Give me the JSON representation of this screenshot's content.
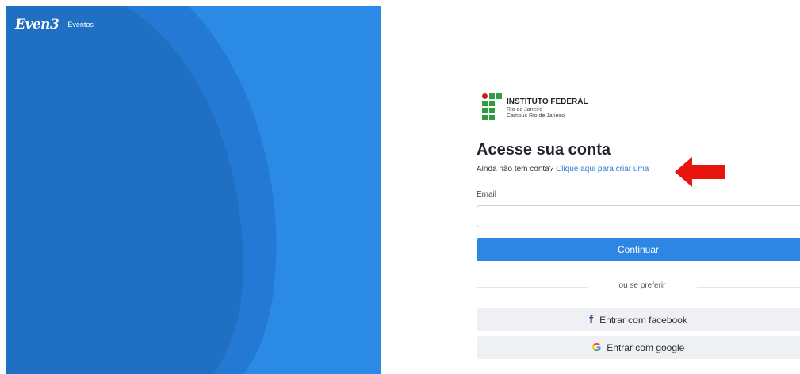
{
  "brand": {
    "logo": "Even3",
    "subtitle": "Eventos"
  },
  "institution": {
    "name": "INSTITUTO FEDERAL",
    "line1": "Rio de Janeiro",
    "line2": "Campus Rio de Janeiro"
  },
  "login": {
    "title": "Acesse sua conta",
    "no_account_text": "Ainda não tem conta?",
    "create_link": "Clique aqui para criar uma",
    "email_label": "Email",
    "email_value": "",
    "email_placeholder": "",
    "continue_label": "Continuar",
    "divider_text": "ou se preferir",
    "facebook_label": "Entrar com facebook",
    "google_label": "Entrar com google"
  },
  "icons": {
    "facebook": "facebook-icon",
    "google": "google-icon",
    "annotation": "red-arrow-icon"
  },
  "colors": {
    "left_panel": "#2b8ae6",
    "left_panel_dark": "#1f6fc2",
    "primary_button": "#2d86e2",
    "link": "#2d7ed6",
    "arrow": "#e8150f",
    "if_green": "#2f9e41",
    "if_red": "#cd191e"
  }
}
